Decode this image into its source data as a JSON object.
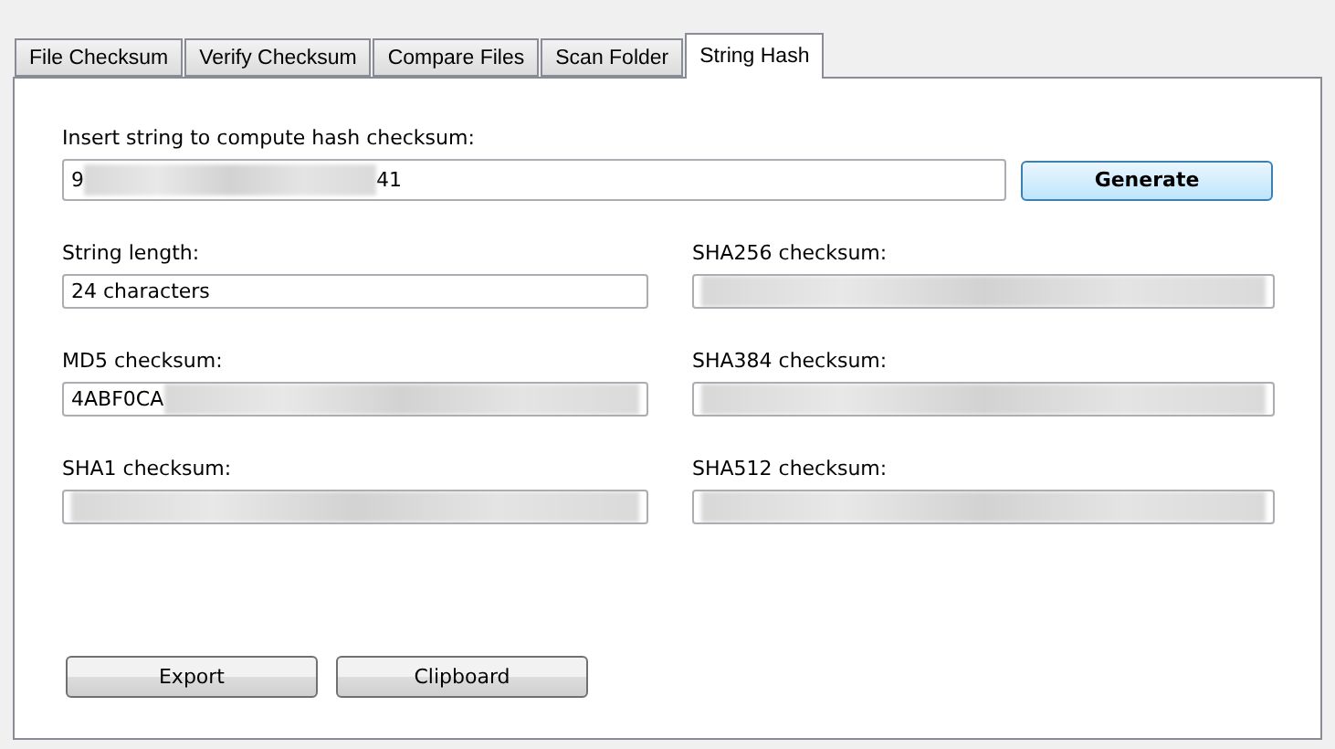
{
  "tabs": [
    {
      "label": "File Checksum",
      "selected": false
    },
    {
      "label": "Verify Checksum",
      "selected": false
    },
    {
      "label": "Compare Files",
      "selected": false
    },
    {
      "label": "Scan Folder",
      "selected": false
    },
    {
      "label": "String Hash",
      "selected": true
    }
  ],
  "input": {
    "label": "Insert string to compute hash checksum:",
    "value_start": "9",
    "value_end": "41",
    "redacted": true
  },
  "generate_button": "Generate",
  "fields": [
    {
      "label": "String length:",
      "value": "24 characters",
      "redacted": false
    },
    {
      "label": "SHA256 checksum:",
      "redacted": true
    },
    {
      "label": "MD5 checksum:",
      "value": "4ABF0CA",
      "redacted": true
    },
    {
      "label": "SHA384 checksum:",
      "redacted": true
    },
    {
      "label": "SHA1 checksum:",
      "redacted": true
    },
    {
      "label": "SHA512 checksum:",
      "redacted": true
    }
  ],
  "buttons": [
    "Export",
    "Clipboard"
  ]
}
